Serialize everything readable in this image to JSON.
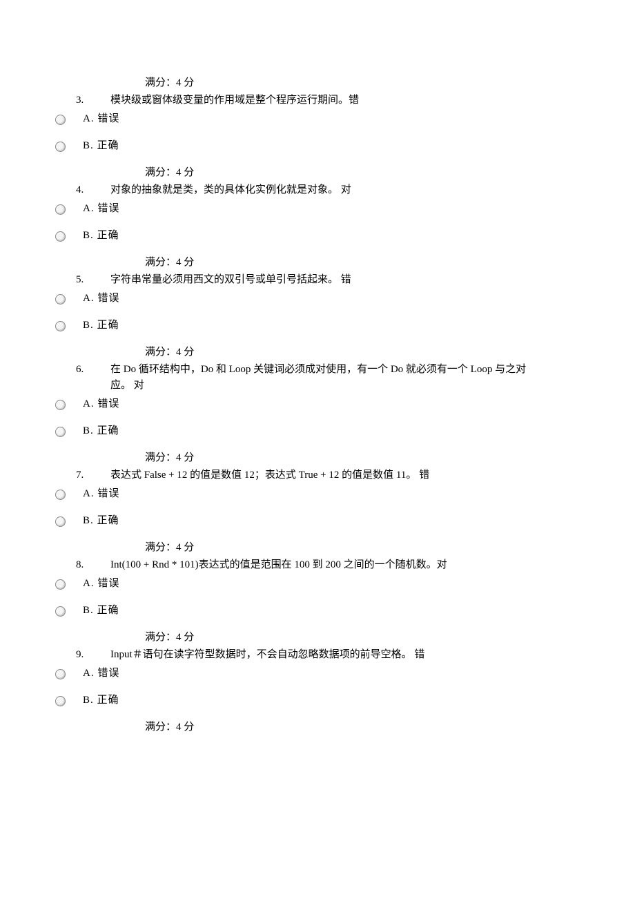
{
  "score_label_prefix": "满分：",
  "score_value": "4",
  "score_label_suffix": "    分",
  "option_a": "A. 错误",
  "option_b": "B. 正确",
  "questions": [
    {
      "num": "3.",
      "text": "模块级或窗体级变量的作用域是整个程序运行期间。错",
      "wrap": ""
    },
    {
      "num": "4.",
      "text": "对象的抽象就是类，类的具体化实例化就是对象。 对",
      "wrap": ""
    },
    {
      "num": "5.",
      "text": "字符串常量必须用西文的双引号或单引号括起来。 错",
      "wrap": ""
    },
    {
      "num": "6.",
      "text": "在 Do 循环结构中，Do 和 Loop 关键词必须成对使用，有一个 Do 就必须有一个 Loop 与之对",
      "wrap": "应。 对"
    },
    {
      "num": "7.",
      "text": "表达式 False + 12 的值是数值 12；表达式 True + 12 的值是数值 11。 错",
      "wrap": ""
    },
    {
      "num": "8.",
      "text": "Int(100 + Rnd * 101)表达式的值是范围在 100 到 200 之间的一个随机数。对",
      "wrap": ""
    },
    {
      "num": "9.",
      "text": "Input＃语句在读字符型数据时，不会自动忽略数据项的前导空格。 错",
      "wrap": ""
    }
  ]
}
